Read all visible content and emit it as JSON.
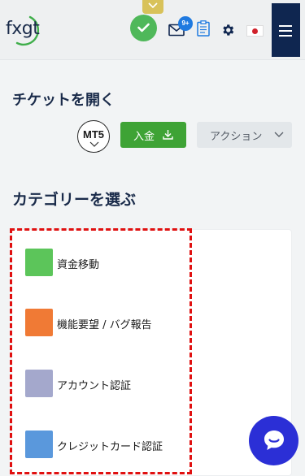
{
  "header": {
    "logo_text": "fxgt",
    "mail_badge": "9+",
    "icons": [
      "chevron-down-icon",
      "check-icon",
      "mail-icon",
      "clipboard-icon",
      "gear-icon",
      "japan-flag-icon",
      "hamburger-menu-icon"
    ]
  },
  "open_ticket": {
    "title": "チケットを開く",
    "platform_label": "MT5",
    "deposit_label": "入金",
    "action_label": "アクション"
  },
  "categories": {
    "title": "カテゴリーを選ぶ",
    "items": [
      {
        "label": "資金移動",
        "color": "#5cc55a"
      },
      {
        "label": "機能要望 / バグ報告",
        "color": "#f07a35"
      },
      {
        "label": "アカウント認証",
        "color": "#a4a8cc"
      },
      {
        "label": "クレジットカード認証",
        "color": "#5a98dc"
      }
    ]
  },
  "colors": {
    "accent_green": "#3ea335",
    "navy": "#0f2650",
    "chat_blue": "#2b2fd6",
    "highlight_red": "#e01010"
  }
}
